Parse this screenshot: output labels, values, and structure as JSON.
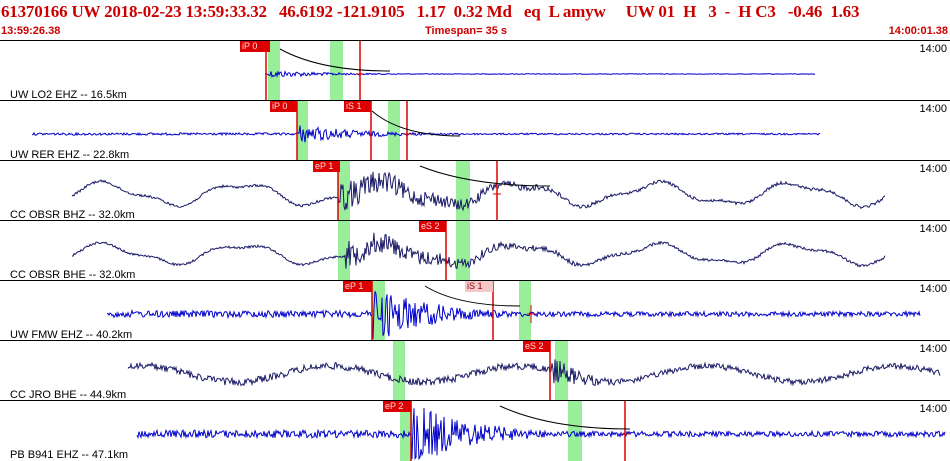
{
  "header": {
    "title": "61370166 UW 2018-02-23 13:59:33.32   46.6192 -121.9105   1.17  0.32 Md   eq  L amyw     UW 01  H   3  -  H C3   -0.46  1.63",
    "time_left": "13:59:26.38",
    "timespan": "Timespan=  35 s",
    "time_right": "14:00:01.38"
  },
  "colors": {
    "title_red": "#cc0000",
    "trace_blue": "#0000cc",
    "trace_navy": "#1a1a66",
    "pick_red": "#dd0000",
    "window_green": "#99ee99"
  },
  "panels": [
    {
      "channel": "UW LO2 EHZ -- 16.5km",
      "time_label": "14:00",
      "trace_color": "blue",
      "picks": [
        {
          "label": "iP 0",
          "style": "red"
        }
      ]
    },
    {
      "channel": "UW RER EHZ -- 22.8km",
      "time_label": "14:00",
      "trace_color": "blue",
      "picks": [
        {
          "label": "iP 0",
          "style": "red"
        },
        {
          "label": "iS 1",
          "style": "red"
        }
      ]
    },
    {
      "channel": "CC OBSR BHZ -- 32.0km",
      "time_label": "14:00",
      "trace_color": "navy",
      "picks": [
        {
          "label": "eP 1",
          "style": "red"
        }
      ]
    },
    {
      "channel": "CC OBSR BHE -- 32.0km",
      "time_label": "14:00",
      "trace_color": "navy",
      "picks": [
        {
          "label": "eS 2",
          "style": "red"
        }
      ]
    },
    {
      "channel": "UW FMW EHZ -- 40.2km",
      "time_label": "14:00",
      "trace_color": "blue",
      "picks": [
        {
          "label": "eP 1",
          "style": "red"
        },
        {
          "label": "iS 1",
          "style": "pink"
        }
      ]
    },
    {
      "channel": "CC JRO BHE -- 44.9km",
      "time_label": "14:00",
      "trace_color": "navy",
      "picks": [
        {
          "label": "eS 2",
          "style": "red"
        }
      ]
    },
    {
      "channel": "PB B941 EHZ -- 47.1km",
      "time_label": "14:00",
      "trace_color": "blue",
      "picks": [
        {
          "label": "eP 2",
          "style": "red"
        }
      ]
    }
  ]
}
